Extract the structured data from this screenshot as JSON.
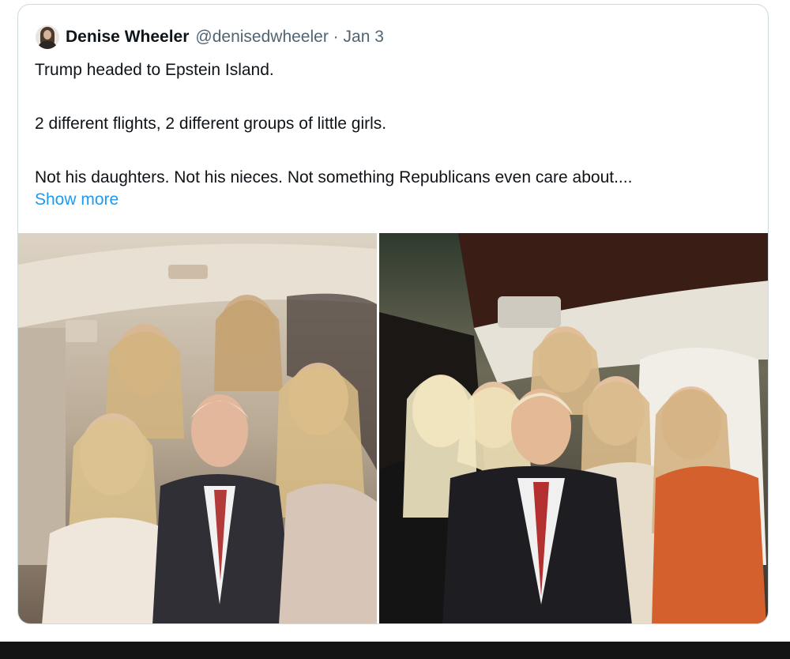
{
  "tweet": {
    "author_name": "Denise Wheeler",
    "author_handle": "@denisedwheeler",
    "separator": "·",
    "date": "Jan 3",
    "lines": [
      "Trump headed to Epstein Island.",
      "2 different flights, 2 different groups of little girls.",
      "Not his daughters. Not his nieces. Not something Republicans even care about...."
    ],
    "show_more": "Show more"
  },
  "media": {
    "images": [
      {
        "name": "left-photo"
      },
      {
        "name": "right-photo"
      }
    ]
  },
  "colors": {
    "text": "#0f1419",
    "secondary": "#536471",
    "link": "#1d9bf0",
    "border": "#cfd9de"
  }
}
